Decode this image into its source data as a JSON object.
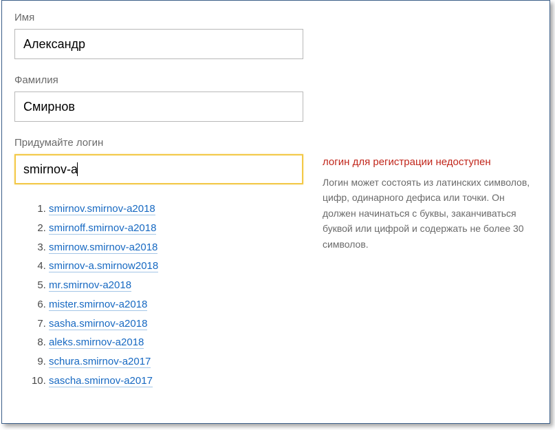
{
  "fields": {
    "firstName": {
      "label": "Имя",
      "value": "Александр"
    },
    "lastName": {
      "label": "Фамилия",
      "value": "Смирнов"
    },
    "login": {
      "label": "Придумайте логин",
      "value": "smirnov-a"
    }
  },
  "validation": {
    "errorTitle": "логин для регистрации недоступен",
    "hint": "Логин может состоять из латинских символов, цифр, одинарного дефиса или точки. Он должен начинаться с буквы, заканчиваться буквой или цифрой и содержать не более 30 символов."
  },
  "suggestions": [
    "smirnov.smirnov-a2018",
    "smirnoff.smirnov-a2018",
    "smirnow.smirnov-a2018",
    "smirnov-a.smirnow2018",
    "mr.smirnov-a2018",
    "mister.smirnov-a2018",
    "sasha.smirnov-a2018",
    "aleks.smirnov-a2018",
    "schura.smirnov-a2017",
    "sascha.smirnov-a2017"
  ]
}
